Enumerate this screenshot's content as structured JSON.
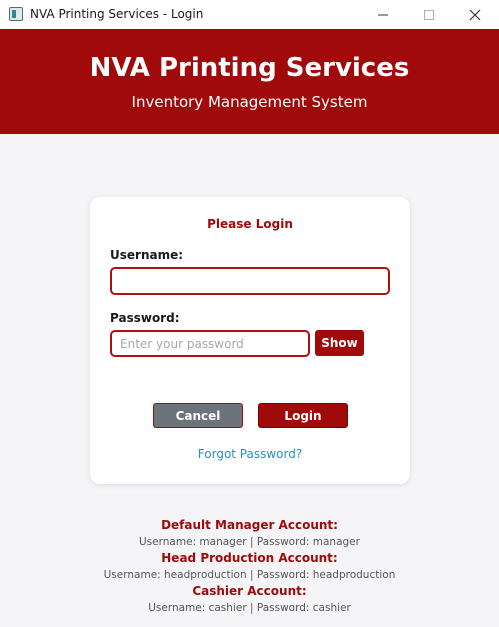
{
  "window": {
    "title": "NVA Printing Services - Login"
  },
  "header": {
    "title": "NVA Printing Services",
    "subtitle": "Inventory Management System"
  },
  "login": {
    "heading": "Please Login",
    "username_label": "Username:",
    "username_value": "",
    "password_label": "Password:",
    "password_placeholder": "Enter your password",
    "show_label": "Show",
    "cancel_label": "Cancel",
    "login_label": "Login",
    "forgot_label": "Forgot Password?"
  },
  "accounts": [
    {
      "title": "Default Manager Account:",
      "credentials": "Username: manager | Password: manager"
    },
    {
      "title": "Head Production Account:",
      "credentials": "Username: headproduction | Password: headproduction"
    },
    {
      "title": "Cashier Account:",
      "credentials": "Username: cashier | Password: cashier"
    }
  ],
  "colors": {
    "brand_red": "#a00a0a",
    "link_blue": "#2a8fb8",
    "cancel_gray": "#6c737a",
    "background": "#f5f5f7"
  },
  "icons": [
    "app-icon",
    "minimize-icon",
    "maximize-icon",
    "close-icon"
  ]
}
